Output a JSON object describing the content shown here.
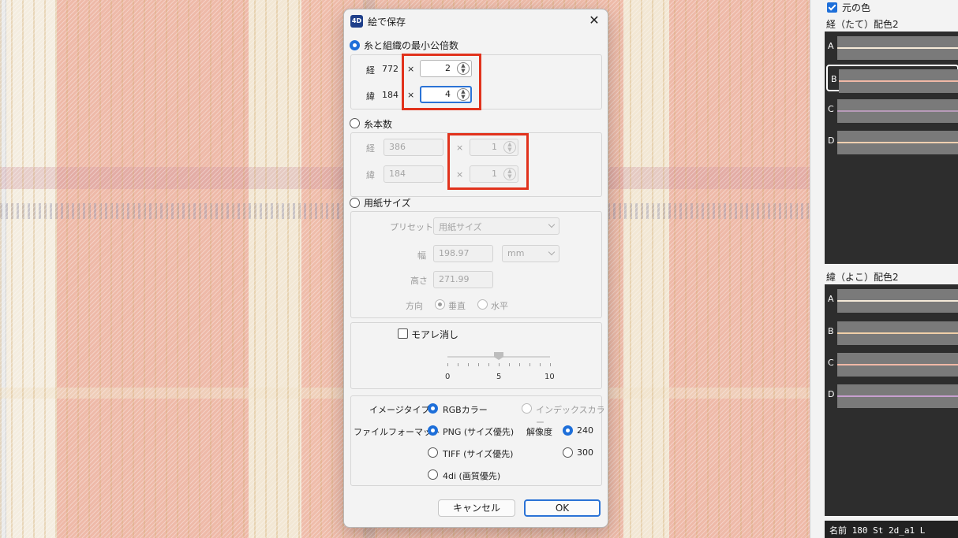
{
  "dialog": {
    "title": "絵で保存",
    "app_icon": "4D",
    "close": "✕",
    "lcm_section": {
      "label": "糸と組織の最小公倍数",
      "warp_label": "経",
      "warp_value": "772",
      "warp_times": "×",
      "warp_multiplier": "2",
      "weft_label": "緯",
      "weft_value": "184",
      "weft_times": "×",
      "weft_multiplier": "4"
    },
    "thread_section": {
      "label": "糸本数",
      "warp_label": "経",
      "warp_value": "386",
      "warp_times": "×",
      "warp_multiplier": "1",
      "weft_label": "緯",
      "weft_value": "184",
      "weft_times": "×",
      "weft_multiplier": "1"
    },
    "paper_section": {
      "label": "用紙サイズ",
      "preset_label": "プリセット",
      "preset_value": "用紙サイズ",
      "width_label": "幅",
      "width_value": "198.97",
      "unit_value": "mm",
      "height_label": "高さ",
      "height_value": "271.99",
      "direction_label": "方向",
      "direction_vertical": "垂直",
      "direction_horizontal": "水平"
    },
    "moire": {
      "label": "モアレ消し",
      "slider_min": "0",
      "slider_mid": "5",
      "slider_max": "10",
      "slider_value": 5
    },
    "output": {
      "image_type_label": "イメージタイプ",
      "rgb_label": "RGBカラー",
      "index_label": "インデックスカラー",
      "format_label": "ファイルフォーマット",
      "png_label": "PNG (サイズ優先)",
      "tiff_label": "TIFF (サイズ優先)",
      "fourdi_label": "4di (画質優先)",
      "resolution_label": "解像度",
      "res_240": "240",
      "res_300": "300"
    },
    "cancel_label": "キャンセル",
    "ok_label": "OK"
  },
  "right_panel": {
    "original_color_label": "元の色",
    "warp_palette_label": "経（たて）配色2",
    "weft_palette_label": "緯（よこ）配色2",
    "warp_rows": [
      {
        "letter": "A",
        "color": "#f5ead8"
      },
      {
        "letter": "B",
        "color": "#f0b8a6"
      },
      {
        "letter": "C",
        "color": "#b79ab8"
      },
      {
        "letter": "D",
        "color": "#f0d0b0"
      }
    ],
    "weft_rows": [
      {
        "letter": "A",
        "color": "#f5ead8"
      },
      {
        "letter": "B",
        "color": "#f0cfa8"
      },
      {
        "letter": "C",
        "color": "#f0b8a6"
      },
      {
        "letter": "D",
        "color": "#c8a0d0"
      }
    ],
    "status_text": "名前  180 St 2d_a1 L"
  },
  "colors": {
    "accent": "#1e6fd9",
    "highlight": "#e1321c"
  }
}
